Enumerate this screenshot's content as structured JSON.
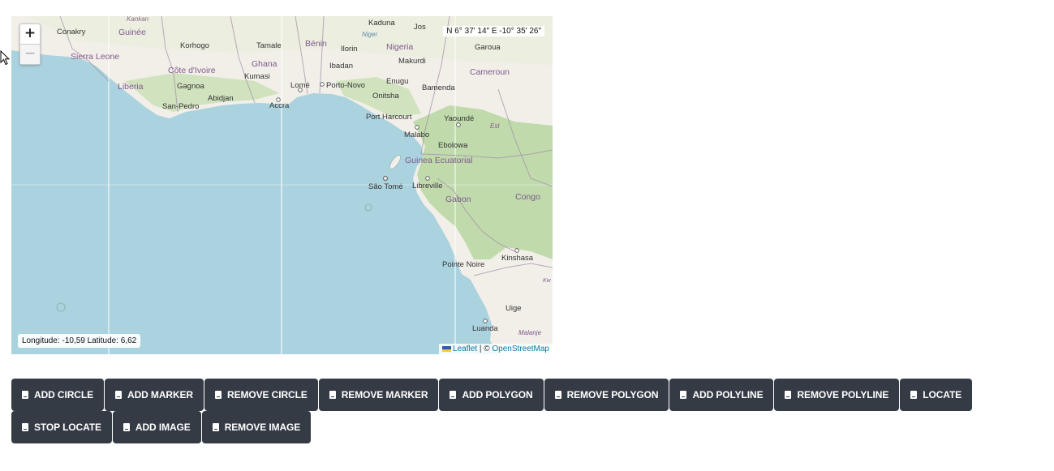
{
  "map": {
    "coordinate_display": "N 6° 37' 14\" E -10° 35' 26\"",
    "mouse_position": "Longitude: -10,59 Latitude: 6,62",
    "zoom_in": "+",
    "zoom_out": "−",
    "attribution": {
      "leaflet": "Leaflet",
      "separator": " | © ",
      "osm": "OpenStreetMap"
    },
    "colors": {
      "water": "#aad3df",
      "land": "#f2efe9",
      "forest": "#b7d6a1",
      "border": "#a08aa6"
    },
    "labels": {
      "kankan": "Kankan",
      "kaduna": "Kaduna",
      "jos": "Jos",
      "conakry": "Conakry",
      "guinee": "Guinée",
      "niger": "Niger",
      "benin": "Bénin",
      "tamale": "Tamale",
      "ilorin": "Ilorin",
      "nigeria": "Nigeria",
      "garoua": "Garoua",
      "korhogo": "Korhogo",
      "sierra_leone": "Sierra Leone",
      "ghana": "Ghana",
      "ibadan": "Ibadan",
      "makurdi": "Makurdi",
      "cote_divoire": "Côte d'Ivoire",
      "kumasi": "Kumasi",
      "cameroun": "Cameroun",
      "gagnoa": "Gagnoa",
      "liberia": "Liberia",
      "lome": "Lomé",
      "porto_novo": "Porto-Novo",
      "enugu": "Enugu",
      "bamenda": "Bamenda",
      "abidjan": "Abidjan",
      "onitsha": "Onitsha",
      "san_pedro": "San-Pedro",
      "accra": "Accra",
      "port_harcourt": "Port Harcourt",
      "yaounde": "Yaoundé",
      "est": "Est",
      "malabo": "Malabo",
      "ebolowa": "Ebolowa",
      "guinea_ecuatorial": "Guinea Ecuatorial",
      "sao_tome": "São Tomé",
      "libreville": "Libreville",
      "gabon": "Gabon",
      "congo": "Congo",
      "pointe_noire": "Pointe Noire",
      "kinshasa": "Kinshasa",
      "kw": "Kw",
      "uige": "Uige",
      "luanda": "Luanda",
      "malanje": "Malanje"
    }
  },
  "buttons": [
    "ADD CIRCLE",
    "ADD MARKER",
    "REMOVE CIRCLE",
    "REMOVE MARKER",
    "ADD POLYGON",
    "REMOVE POLYGON",
    "ADD POLYLINE",
    "REMOVE POLYLINE",
    "LOCATE",
    "STOP LOCATE",
    "ADD IMAGE",
    "REMOVE IMAGE"
  ]
}
